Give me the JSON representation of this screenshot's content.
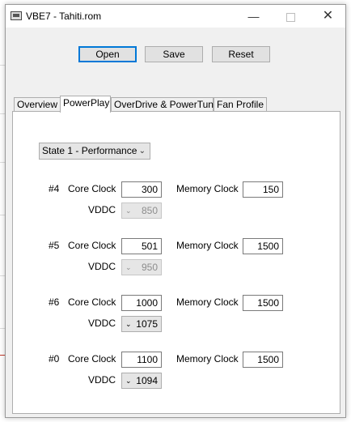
{
  "window": {
    "title": "VBE7 - Tahiti.rom"
  },
  "toolbar": {
    "open_label": "Open",
    "save_label": "Save",
    "reset_label": "Reset"
  },
  "tabs": [
    {
      "label": "Overview"
    },
    {
      "label": "PowerPlay"
    },
    {
      "label": "OverDrive & PowerTune"
    },
    {
      "label": "Fan Profile"
    }
  ],
  "active_tab": "PowerPlay",
  "powerplay": {
    "state_select": "State 1 - Performance",
    "labels": {
      "core_clock": "Core Clock",
      "memory_clock": "Memory Clock",
      "vddc": "VDDC"
    },
    "states": [
      {
        "id": "#4",
        "core_clock": "300",
        "memory_clock": "150",
        "vddc": "850",
        "vddc_enabled": false
      },
      {
        "id": "#5",
        "core_clock": "501",
        "memory_clock": "1500",
        "vddc": "950",
        "vddc_enabled": false
      },
      {
        "id": "#6",
        "core_clock": "1000",
        "memory_clock": "1500",
        "vddc": "1075",
        "vddc_enabled": true
      },
      {
        "id": "#0",
        "core_clock": "1100",
        "memory_clock": "1500",
        "vddc": "1094",
        "vddc_enabled": true
      }
    ]
  },
  "icons": {
    "app": "app-window-icon",
    "minimize": "minimize-icon",
    "maximize": "maximize-icon",
    "close": "close-icon",
    "dropdown": "chevron-down-icon"
  }
}
